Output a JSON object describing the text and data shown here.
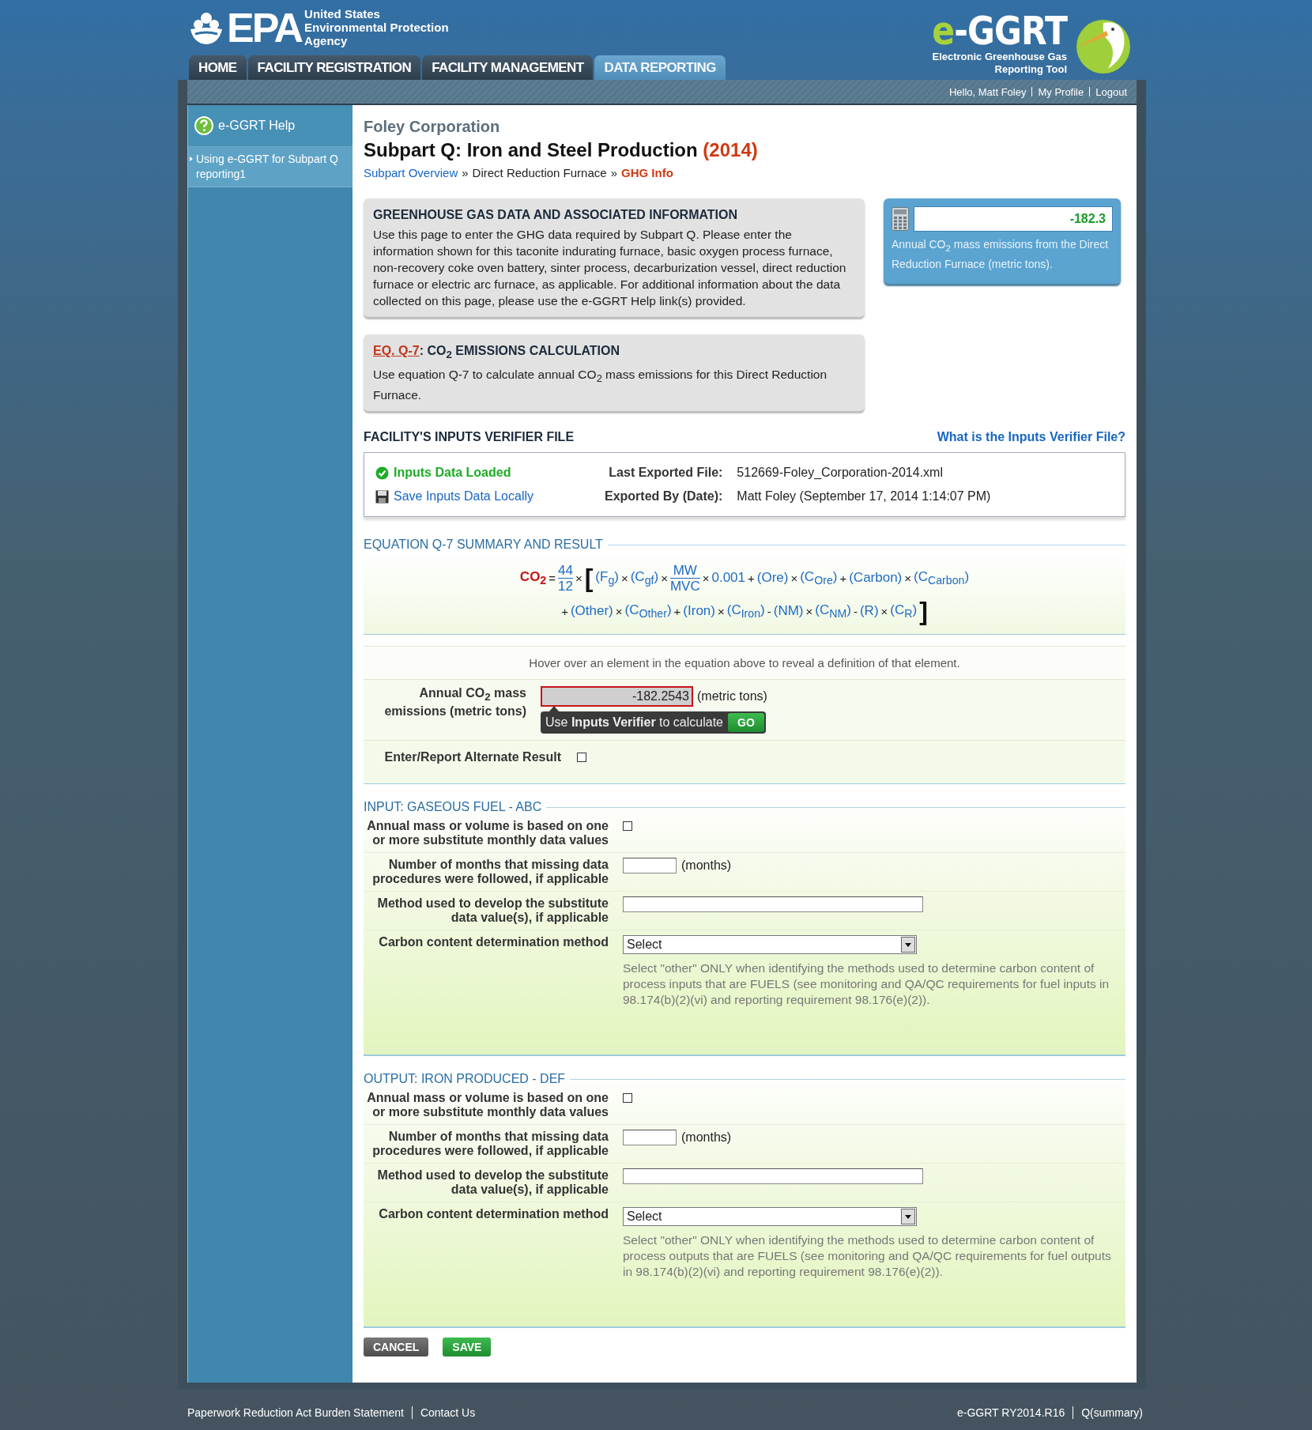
{
  "header": {
    "agency_logo": {
      "mark": "EPA",
      "lines": [
        "United States",
        "Environmental Protection",
        "Agency"
      ]
    },
    "tool_logo": {
      "prefix": "e",
      "name": "-GGRT",
      "subtitle_lines": [
        "Electronic Greenhouse Gas",
        "Reporting Tool"
      ]
    },
    "tabs": [
      {
        "label": "HOME",
        "selected": false
      },
      {
        "label": "FACILITY REGISTRATION",
        "selected": false
      },
      {
        "label": "FACILITY MANAGEMENT",
        "selected": false
      },
      {
        "label": "DATA REPORTING",
        "selected": true
      }
    ],
    "greeting": "Hello, Matt Foley",
    "user_links": [
      "My Profile",
      "Logout"
    ]
  },
  "sidebar": {
    "help_title": "e-GGRT Help",
    "items": [
      "Using e-GGRT for Subpart Q reporting1"
    ]
  },
  "page": {
    "company": "Foley Corporation",
    "title": "Subpart Q: Iron and Steel Production",
    "year": "(2014)",
    "breadcrumb": [
      {
        "label": "Subpart Overview",
        "kind": "link"
      },
      {
        "label": "»",
        "kind": "sep"
      },
      {
        "label": "Direct Reduction Furnace",
        "kind": "text"
      },
      {
        "label": "»",
        "kind": "sep"
      },
      {
        "label": "GHG Info",
        "kind": "current"
      }
    ]
  },
  "info_box": {
    "title": "GREENHOUSE GAS DATA AND ASSOCIATED INFORMATION",
    "text": "Use this page to enter the GHG data required by Subpart Q. Please enter the information shown for this taconite indurating furnace, basic oxygen process furnace, non-recovery coke oven battery, sinter process, decarburization vessel, direct reduction furnace or electric arc furnace, as applicable. For additional information about the data collected on this page, please use the e-GGRT Help link(s) provided."
  },
  "equation_box": {
    "link": "EQ. Q-7",
    "title": ": CO$_{2}$ EMISSIONS CALCULATION",
    "text": "Use equation Q-7 to calculate annual CO$_{2}$ mass emissions for this Direct Reduction Furnace."
  },
  "result_panel": {
    "value": "-182.3",
    "caption": "Annual CO$_{2}$ mass emissions from the Direct Reduction Furnace (metric tons)."
  },
  "verifier": {
    "title": "FACILITY'S INPUTS VERIFIER FILE",
    "help_link": "What is the Inputs Verifier File?",
    "status": "Inputs Data Loaded",
    "save_link": "Save Inputs Data Locally",
    "details": [
      {
        "label": "Last Exported File:",
        "value": "512669-Foley_Corporation-2014.xml"
      },
      {
        "label": "Exported By (Date):",
        "value": "Matt Foley (September 17, 2014 1:14:07 PM)"
      }
    ]
  },
  "equation_section": {
    "title": "EQUATION Q-7 SUMMARY AND RESULT",
    "lines": [
      [
        {
          "kind": "lhs",
          "text": "CO$_{2}$"
        },
        {
          "kind": "op",
          "text": "="
        },
        {
          "kind": "fraction",
          "num": "44",
          "den": "12"
        },
        {
          "kind": "op",
          "text": "×"
        },
        {
          "kind": "bracket",
          "text": "["
        },
        {
          "kind": "term",
          "text": "(F$_{g}$)"
        },
        {
          "kind": "op",
          "text": "×"
        },
        {
          "kind": "term",
          "text": "(C$_{gf}$)"
        },
        {
          "kind": "op",
          "text": "×"
        },
        {
          "kind": "fraction",
          "num": "MW",
          "den": "MVC"
        },
        {
          "kind": "op",
          "text": "×"
        },
        {
          "kind": "term",
          "text": "0.001"
        },
        {
          "kind": "op",
          "text": "+"
        },
        {
          "kind": "term",
          "text": "(Ore)"
        },
        {
          "kind": "op",
          "text": "×"
        },
        {
          "kind": "term",
          "text": "(C$_{Ore}$)"
        },
        {
          "kind": "op",
          "text": "+"
        },
        {
          "kind": "term",
          "text": "(Carbon)"
        },
        {
          "kind": "op",
          "text": "×"
        },
        {
          "kind": "term",
          "text": "(C$_{Carbon}$)"
        }
      ],
      [
        {
          "kind": "op",
          "text": "+"
        },
        {
          "kind": "term",
          "text": "(Other)"
        },
        {
          "kind": "op",
          "text": "×"
        },
        {
          "kind": "term",
          "text": "(C$_{Other}$)"
        },
        {
          "kind": "op",
          "text": "+"
        },
        {
          "kind": "term",
          "text": "(Iron)"
        },
        {
          "kind": "op",
          "text": "×"
        },
        {
          "kind": "term",
          "text": "(C$_{Iron}$)"
        },
        {
          "kind": "op",
          "text": "-"
        },
        {
          "kind": "term",
          "text": "(NM)"
        },
        {
          "kind": "op",
          "text": "×"
        },
        {
          "kind": "term",
          "text": "(C$_{NM}$)"
        },
        {
          "kind": "op",
          "text": "-"
        },
        {
          "kind": "term",
          "text": "(R)"
        },
        {
          "kind": "op",
          "text": "×"
        },
        {
          "kind": "term",
          "text": "(C$_{R}$)"
        },
        {
          "kind": "bracket",
          "text": "]"
        }
      ]
    ],
    "hint": "Hover over an element in the equation above to reveal a definition of that element.",
    "result": {
      "label": "Annual CO$_{2}$ mass emissions (metric tons)",
      "value": "-182.2543",
      "unit": "(metric tons)",
      "tooltip": "Use **Inputs Verifier** to calculate",
      "go": "GO"
    },
    "alternate": {
      "label": "Enter/Report Alternate Result",
      "checked": false
    }
  },
  "sections": [
    {
      "title": "INPUT: GASEOUS FUEL - ABC",
      "rows": [
        {
          "kind": "checkbox",
          "label": "Annual mass or volume is based on one or more substitute monthly data values",
          "checked": false
        },
        {
          "kind": "number",
          "label": "Number of months that missing data procedures were followed, if applicable",
          "unit": "(months)"
        },
        {
          "kind": "text",
          "label": "Method used to develop the substitute data value(s), if applicable"
        },
        {
          "kind": "select",
          "label": "Carbon content determination method",
          "value": "Select",
          "note": "Select \"other\" ONLY when identifying the methods used to determine carbon content of process inputs that are FUELS (see monitoring and QA/QC requirements for fuel inputs in 98.174(b)(2)(vi) and reporting requirement 98.176(e)(2))."
        }
      ]
    },
    {
      "title": "OUTPUT: IRON PRODUCED - DEF",
      "rows": [
        {
          "kind": "checkbox",
          "label": "Annual mass or volume is based on one or more substitute monthly data values",
          "checked": false
        },
        {
          "kind": "number",
          "label": "Number of months that missing data procedures were followed, if applicable",
          "unit": "(months)"
        },
        {
          "kind": "text",
          "label": "Method used to develop the substitute data value(s), if applicable"
        },
        {
          "kind": "select",
          "label": "Carbon content determination method",
          "value": "Select",
          "note": "Select \"other\" ONLY when identifying the methods used to determine carbon content of process outputs that are FUELS (see monitoring and QA/QC requirements for fuel outputs in 98.174(b)(2)(vi) and reporting requirement 98.176(e)(2))."
        }
      ]
    }
  ],
  "actions": [
    {
      "label": "CANCEL",
      "kind": "cancel"
    },
    {
      "label": "SAVE",
      "kind": "save"
    }
  ],
  "footer": {
    "left": [
      "Paperwork Reduction Act Burden Statement",
      "Contact Us"
    ],
    "right": [
      "e-GGRT RY2014.R16",
      "Q(summary)"
    ]
  }
}
